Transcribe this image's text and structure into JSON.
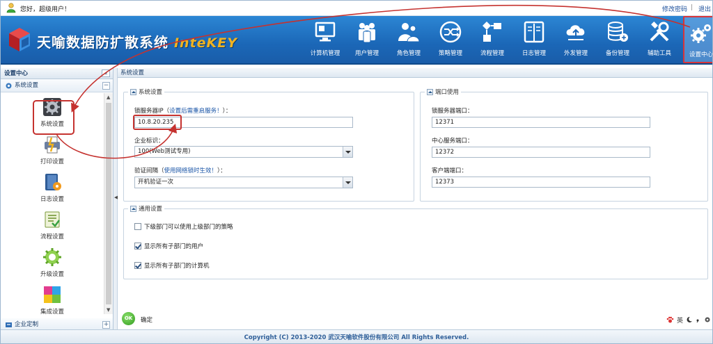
{
  "topbar": {
    "greeting": "您好，超级用户！",
    "change_password": "修改密码",
    "separator": "|",
    "logout": "退出"
  },
  "header": {
    "title": "天喻数据防扩散系统",
    "brand": "InteKEY",
    "nav": [
      {
        "label": "计算机管理",
        "icon": "computer-icon"
      },
      {
        "label": "用户管理",
        "icon": "users-icon"
      },
      {
        "label": "角色管理",
        "icon": "roles-icon"
      },
      {
        "label": "策略管理",
        "icon": "policy-icon"
      },
      {
        "label": "流程管理",
        "icon": "workflow-icon"
      },
      {
        "label": "日志管理",
        "icon": "log-book-icon"
      },
      {
        "label": "外发管理",
        "icon": "outgoing-icon"
      },
      {
        "label": "备份管理",
        "icon": "backup-icon"
      },
      {
        "label": "辅助工具",
        "icon": "tools-icon"
      },
      {
        "label": "设置中心",
        "icon": "gears-icon"
      }
    ],
    "active_nav": "设置中心"
  },
  "sidebar": {
    "title": "设置中心",
    "collapse": "«",
    "group1": {
      "label": "系统设置",
      "toggle": "−"
    },
    "items": [
      {
        "label": "系统设置",
        "icon": "system-settings-icon"
      },
      {
        "label": "打印设置",
        "icon": "printer-icon"
      },
      {
        "label": "日志设置",
        "icon": "log-settings-icon"
      },
      {
        "label": "流程设置",
        "icon": "flow-settings-icon"
      },
      {
        "label": "升级设置",
        "icon": "upgrade-icon"
      },
      {
        "label": "集成设置",
        "icon": "integration-icon"
      }
    ],
    "group2": {
      "label": "企业定制",
      "toggle": "+"
    }
  },
  "main": {
    "title": "系统设置",
    "system_settings": {
      "legend": "系统设置",
      "lock_server_ip_label": "锁服务器IP（",
      "lock_server_ip_hint": "设置后需重启服务！",
      "lock_server_ip_label_end": "）：",
      "lock_server_ip_value": "10.8.20.235",
      "enterprise_id_label": "企业标识：",
      "enterprise_id_value": "100(Web测试专用)",
      "verify_interval_label": "验证间隔（",
      "verify_interval_hint": "使用网络锁时生效！",
      "verify_interval_label_end": "）：",
      "verify_interval_value": "开机验证一次"
    },
    "port_usage": {
      "legend": "端口使用",
      "lock_port_label": "锁服务器端口：",
      "lock_port_value": "12371",
      "center_port_label": "中心服务端口：",
      "center_port_value": "12372",
      "client_port_label": "客户端端口：",
      "client_port_value": "12373"
    },
    "general": {
      "legend": "通用设置",
      "options": [
        {
          "label": "下级部门可以使用上级部门的策略",
          "checked": false
        },
        {
          "label": "显示所有子部门的用户",
          "checked": true
        },
        {
          "label": "显示所有子部门的计算机",
          "checked": true
        }
      ]
    },
    "ok_icon": "OK",
    "ok_label": "确定"
  },
  "ime": {
    "lang": "英",
    "icons": [
      "paw-icon",
      "moon-icon",
      "comma-icon",
      "gear-icon"
    ]
  },
  "footer": "Copyright (C) 2013-2020 武汉天喻软件股份有限公司 All Rights Reserved.",
  "colors": {
    "accent": "#1b67b7",
    "highlight": "#c5322f",
    "brand": "#f0b322"
  }
}
